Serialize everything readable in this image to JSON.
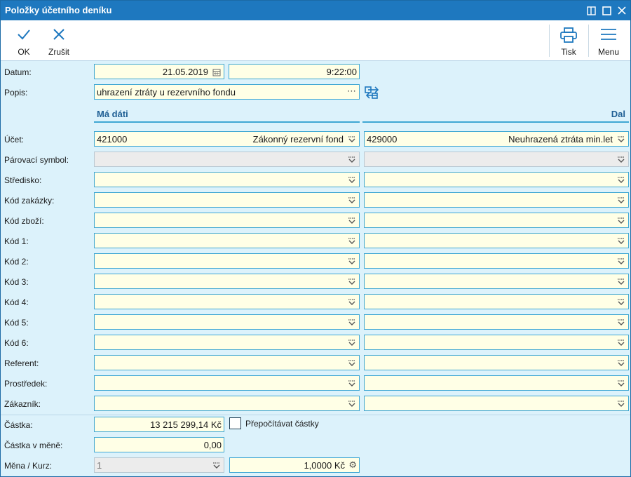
{
  "window": {
    "title": "Položky účetního deníku"
  },
  "toolbar": {
    "ok_label": "OK",
    "cancel_label": "Zrušit",
    "print_label": "Tisk",
    "menu_label": "Menu"
  },
  "header": {
    "date_label": "Datum:",
    "date_value": "21.05.2019",
    "time_value": "9:22:00",
    "desc_label": "Popis:",
    "desc_value": "uhrazení ztráty u rezervního fondu"
  },
  "columns": {
    "debit": "Má dáti",
    "credit": "Dal"
  },
  "rows": [
    {
      "label": "Účet:",
      "debit_code": "421000",
      "debit_name": "Zákonný rezervní fond",
      "credit_code": "429000",
      "credit_name": "Neuhrazená ztráta min.let"
    },
    {
      "label": "Párovací symbol:"
    },
    {
      "label": "Středisko:"
    },
    {
      "label": "Kód zakázky:"
    },
    {
      "label": "Kód zboží:"
    },
    {
      "label": "Kód 1:"
    },
    {
      "label": "Kód 2:"
    },
    {
      "label": "Kód 3:"
    },
    {
      "label": "Kód 4:"
    },
    {
      "label": "Kód 5:"
    },
    {
      "label": "Kód 6:"
    },
    {
      "label": "Referent:"
    },
    {
      "label": "Prostředek:"
    },
    {
      "label": "Zákazník:"
    }
  ],
  "amount": {
    "label": "Částka:",
    "value": "13 215 299,14 Kč",
    "recalc_label": "Přepočítávat částky"
  },
  "amount_currency": {
    "label": "Částka v měně:",
    "value": "0,00"
  },
  "currency": {
    "label": "Měna / Kurz:",
    "code": "1",
    "rate": "1,0000 Kč"
  }
}
